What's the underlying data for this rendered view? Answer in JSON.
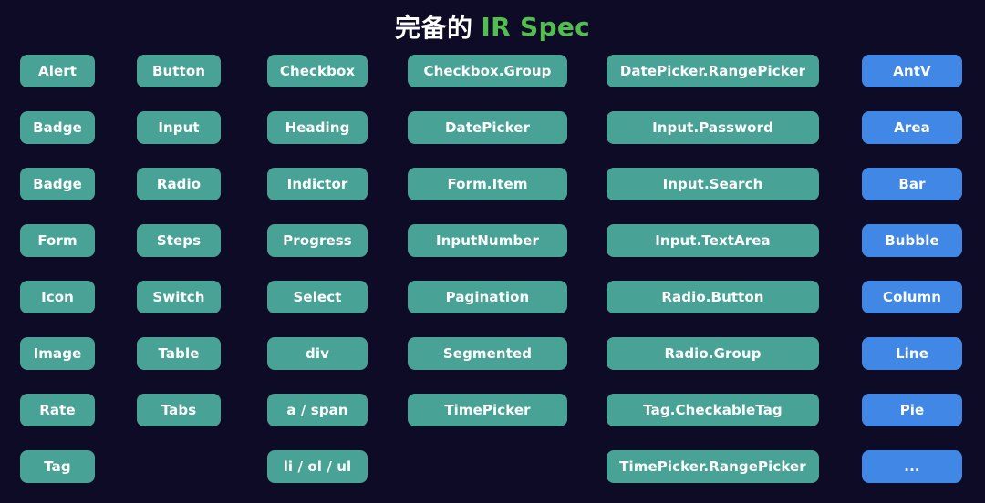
{
  "title": {
    "cn": "完备的",
    "space": " ",
    "en": "IR Spec"
  },
  "colors": {
    "background": "#0d0b26",
    "pill_teal": "#48a295",
    "pill_blue": "#4188e6",
    "title_white": "#ffffff",
    "title_green": "#52be50",
    "pill_text": "#ffffff"
  },
  "columns": [
    {
      "name": "column-1",
      "variant": "teal",
      "items": [
        {
          "label": "Alert"
        },
        {
          "label": "Badge"
        },
        {
          "label": "Badge"
        },
        {
          "label": "Form"
        },
        {
          "label": "Icon"
        },
        {
          "label": "Image"
        },
        {
          "label": "Rate"
        },
        {
          "label": "Tag"
        }
      ]
    },
    {
      "name": "column-2",
      "variant": "teal",
      "items": [
        {
          "label": "Button"
        },
        {
          "label": "Input"
        },
        {
          "label": "Radio"
        },
        {
          "label": "Steps"
        },
        {
          "label": "Switch"
        },
        {
          "label": "Table"
        },
        {
          "label": "Tabs"
        },
        {
          "label": "",
          "empty": true
        }
      ]
    },
    {
      "name": "column-3",
      "variant": "teal",
      "items": [
        {
          "label": "Checkbox"
        },
        {
          "label": "Heading"
        },
        {
          "label": "Indictor"
        },
        {
          "label": "Progress"
        },
        {
          "label": "Select"
        },
        {
          "label": "div"
        },
        {
          "label": "a / span"
        },
        {
          "label": "li / ol / ul"
        }
      ]
    },
    {
      "name": "column-4",
      "variant": "teal",
      "items": [
        {
          "label": "Checkbox.Group"
        },
        {
          "label": "DatePicker"
        },
        {
          "label": "Form.Item"
        },
        {
          "label": "InputNumber"
        },
        {
          "label": "Pagination"
        },
        {
          "label": "Segmented"
        },
        {
          "label": "TimePicker"
        },
        {
          "label": "",
          "empty": true
        }
      ]
    },
    {
      "name": "column-5",
      "variant": "teal",
      "items": [
        {
          "label": "DatePicker.RangePicker"
        },
        {
          "label": "Input.Password"
        },
        {
          "label": "Input.Search"
        },
        {
          "label": "Input.TextArea"
        },
        {
          "label": "Radio.Button"
        },
        {
          "label": "Radio.Group"
        },
        {
          "label": "Tag.CheckableTag"
        },
        {
          "label": "TimePicker.RangePicker"
        }
      ]
    },
    {
      "name": "column-6",
      "variant": "blue",
      "items": [
        {
          "label": "AntV"
        },
        {
          "label": "Area"
        },
        {
          "label": "Bar"
        },
        {
          "label": "Bubble"
        },
        {
          "label": "Column"
        },
        {
          "label": "Line"
        },
        {
          "label": "Pie"
        },
        {
          "label": "..."
        }
      ]
    }
  ]
}
